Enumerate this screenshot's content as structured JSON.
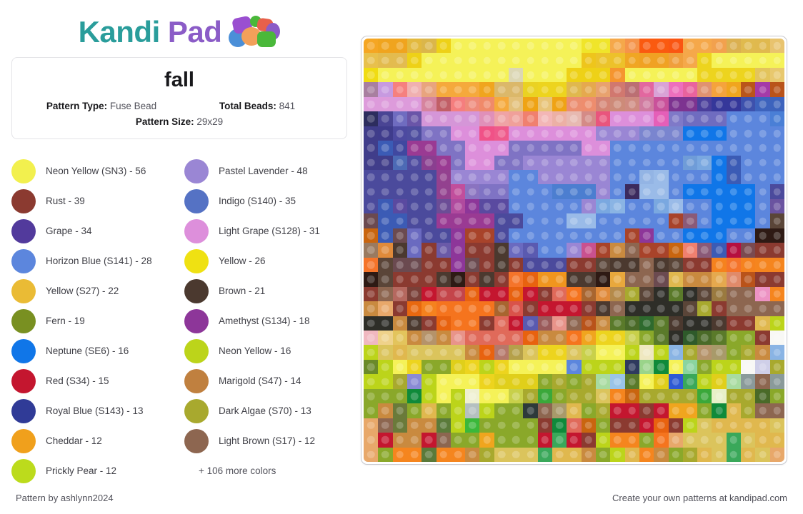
{
  "brand": {
    "name_part1": "Kandi",
    "name_part2": "Pad",
    "teal": "#2a9d9b",
    "purple": "#8b5cc7"
  },
  "info_card": {
    "title": "fall",
    "pattern_type_label": "Pattern Type:",
    "pattern_type_value": "Fuse Bead",
    "total_beads_label": "Total Beads:",
    "total_beads_value": "841",
    "pattern_size_label": "Pattern Size:",
    "pattern_size_value": "29x29"
  },
  "legend": {
    "items": [
      {
        "color": "#f2f04e",
        "label": "Neon Yellow (SN3) - 56"
      },
      {
        "color": "#9a86d4",
        "label": "Pastel Lavender - 48"
      },
      {
        "color": "#8b3a30",
        "label": "Rust - 39"
      },
      {
        "color": "#5572c4",
        "label": "Indigo (S140) - 35"
      },
      {
        "color": "#523a9c",
        "label": "Grape - 34"
      },
      {
        "color": "#dd8fdb",
        "label": "Light Grape (S128) - 31"
      },
      {
        "color": "#5c86dd",
        "label": "Horizon Blue (S141) - 28"
      },
      {
        "color": "#efe112",
        "label": "Yellow - 26"
      },
      {
        "color": "#eabb35",
        "label": "Yellow (S27) - 22"
      },
      {
        "color": "#4b392f",
        "label": "Brown - 21"
      },
      {
        "color": "#799021",
        "label": "Fern - 19"
      },
      {
        "color": "#8d3699",
        "label": "Amethyst (S134) - 18"
      },
      {
        "color": "#1076e8",
        "label": "Neptune (SE6) - 16"
      },
      {
        "color": "#bcd41a",
        "label": "Neon Yellow - 16"
      },
      {
        "color": "#c4162f",
        "label": "Red (S34) - 15"
      },
      {
        "color": "#c0803f",
        "label": "Marigold (S47) - 14"
      },
      {
        "color": "#303b97",
        "label": "Royal Blue (S143) - 13"
      },
      {
        "color": "#a8a92e",
        "label": "Dark Algae (S70) - 13"
      },
      {
        "color": "#f0a01c",
        "label": "Cheddar - 12"
      },
      {
        "color": "#8d6650",
        "label": "Light Brown (S17) - 12"
      },
      {
        "color": "#bcdb1c",
        "label": "Prickly Pear - 12"
      }
    ],
    "more_colors": "+ 106 more colors"
  },
  "pattern": {
    "rows": 29,
    "cols": 29,
    "grid": [
      [
        "#f5a623",
        "#f0a41e",
        "#f0a41e",
        "#e3b93e",
        "#dbb64a",
        "#eed117",
        "#f5f258",
        "#f5f258",
        "#f5f258",
        "#f5f258",
        "#f5f258",
        "#f5f258",
        "#f5f258",
        "#f5f258",
        "#f5f258",
        "#f0e52a",
        "#f0e52a",
        "#f5a84a",
        "#f5944a",
        "#fa5a10",
        "#fa5a10",
        "#fa5512",
        "#f5a84a",
        "#f5a84a",
        "#f2a14e",
        "#dbb050",
        "#e0ba4e",
        "#e0b94e",
        "#e8c36e"
      ],
      [
        "#e8c04c",
        "#e3bb4e",
        "#e3bb50",
        "#eed117",
        "#f5f258",
        "#f5f258",
        "#f5f258",
        "#f5f258",
        "#f5f258",
        "#f5f258",
        "#f5f258",
        "#f5f258",
        "#f5f258",
        "#f5f258",
        "#f5f258",
        "#eec51c",
        "#ecc42a",
        "#edc12a",
        "#f0a623",
        "#f0a123",
        "#f0a123",
        "#f09f3c",
        "#f5a84a",
        "#edd41e",
        "#f5f258",
        "#f5f258",
        "#f5f258",
        "#f5f258",
        "#f5f258"
      ],
      [
        "#f0dc12",
        "#f5f258",
        "#f5f258",
        "#f5f258",
        "#f5f258",
        "#f5f258",
        "#f5f258",
        "#f5f258",
        "#f5f258",
        "#f5f258",
        "#dcd7b4",
        "#f5f258",
        "#f5f258",
        "#f5f258",
        "#eed117",
        "#eed117",
        "#eed117",
        "#f5952f",
        "#f5f258",
        "#f5f258",
        "#f5f258",
        "#f5f258",
        "#f5f258",
        "#edd41e",
        "#edd41e",
        "#edd41e",
        "#edd41e",
        "#e3c45c",
        "#e8c86e"
      ],
      [
        "#a87fa0",
        "#c79ae0",
        "#f5807f",
        "#f0b0b0",
        "#e8a47e",
        "#f5a93c",
        "#f5a93c",
        "#f5a93c",
        "#f0a51e",
        "#dbb86a",
        "#dbb86a",
        "#ead222",
        "#edd41e",
        "#edd41e",
        "#e0b84e",
        "#e5a94e",
        "#e8a26e",
        "#d1786f",
        "#bb6f73",
        "#e2679f",
        "#d9a3d6",
        "#ed6fbd",
        "#e9639e",
        "#e09270",
        "#f5a33c",
        "#f0a51e",
        "#b9551a",
        "#a43aa8",
        "#b9531a"
      ],
      [
        "#dd9bdb",
        "#dd9bdb",
        "#dd9bdb",
        "#dd9bdb",
        "#d6849e",
        "#c15f66",
        "#f57e7e",
        "#ef8a7a",
        "#f08a6a",
        "#f5a93c",
        "#e3c07a",
        "#efa314",
        "#e8c478",
        "#efa314",
        "#ec8e70",
        "#ee8d6e",
        "#d58474",
        "#cd8b79",
        "#cf8a80",
        "#d07ba0",
        "#c9519a",
        "#7d3390",
        "#7d3390",
        "#4a3e9b",
        "#35379a",
        "#35379a",
        "#3d51ad",
        "#3d63bd",
        "#3d63bd"
      ],
      [
        "#2d2d5e",
        "#4a4594",
        "#6f6cc0",
        "#6a55a8",
        "#d596d8",
        "#d596d8",
        "#d596d8",
        "#d596d8",
        "#e090b9",
        "#efa3a5",
        "#f0a09a",
        "#f0806f",
        "#f3b6b6",
        "#ecb0a5",
        "#e7b9b1",
        "#d48b87",
        "#e9557d",
        "#dd8fdb",
        "#dd8fdb",
        "#dd8fdb",
        "#e55fb8",
        "#7f79c8",
        "#6f6cc0",
        "#6f6cc0",
        "#6f6cc0",
        "#5c86dd",
        "#5c86dd",
        "#5c86dd",
        "#4a7fd6"
      ],
      [
        "#403d8a",
        "#3f3c8c",
        "#4d4aa0",
        "#4e4d9f",
        "#7f73c4",
        "#7f73c4",
        "#dd8fdb",
        "#dd8fdb",
        "#f05287",
        "#ef5a8b",
        "#dd8fdb",
        "#dd8fdb",
        "#dd8fdb",
        "#dd8fdb",
        "#dd8fdb",
        "#dd8fdb",
        "#9a86d4",
        "#9a86d4",
        "#9a86d4",
        "#7a85cf",
        "#7a85cf",
        "#7a85cf",
        "#1076e8",
        "#1076e8",
        "#1076e8",
        "#5c86dd",
        "#5c86dd",
        "#5c86dd",
        "#5c86dd"
      ],
      [
        "#403d8a",
        "#3b5bb5",
        "#4048a0",
        "#9a3a93",
        "#9a3a93",
        "#7f73c4",
        "#7f73c4",
        "#dd8fdb",
        "#dd8fdb",
        "#dd8fdb",
        "#7f73c4",
        "#7f73c4",
        "#7f73c4",
        "#7f73c4",
        "#7f73c4",
        "#dd8fdb",
        "#dd8fdb",
        "#5c86dd",
        "#5c86dd",
        "#5c86dd",
        "#5c86dd",
        "#5c86dd",
        "#5c86dd",
        "#5c86dd",
        "#5c86dd",
        "#5c86dd",
        "#5c86dd",
        "#5c86dd",
        "#5c86dd"
      ],
      [
        "#403d8a",
        "#403d8a",
        "#4c6ab5",
        "#4e4ba0",
        "#8a3f90",
        "#9a3a93",
        "#7f73c4",
        "#dd8fdb",
        "#dd8fdb",
        "#7f73c4",
        "#7f73c4",
        "#9a86d4",
        "#9a86d4",
        "#9a86d4",
        "#9a86d4",
        "#9a86d4",
        "#9a86d4",
        "#5c86dd",
        "#5c86dd",
        "#5c86dd",
        "#5c86dd",
        "#5c86dd",
        "#6f9cd8",
        "#7aa8e0",
        "#1076e8",
        "#3b5bb5",
        "#5c86dd",
        "#5c86dd",
        "#5c86dd"
      ],
      [
        "#4b4a9c",
        "#4b4a9c",
        "#4b4a9c",
        "#4b4a9c",
        "#4b4a9c",
        "#93418f",
        "#9a86d4",
        "#9a86d4",
        "#9a86d4",
        "#9a86d4",
        "#5c86dd",
        "#5c86dd",
        "#9a86d4",
        "#9a86d4",
        "#9a86d4",
        "#9a86d4",
        "#9a86d4",
        "#5c86dd",
        "#5c86dd",
        "#93b4e4",
        "#9abbe8",
        "#5c86dd",
        "#5c86dd",
        "#5c86dd",
        "#1076e8",
        "#3b5bb5",
        "#5c86dd",
        "#5c86dd",
        "#5c86dd"
      ],
      [
        "#4b4a9c",
        "#4b4a9c",
        "#4b4a9c",
        "#4b4a9c",
        "#4b4a9c",
        "#93418f",
        "#c14e9c",
        "#8a73c0",
        "#7f73c4",
        "#7f73c4",
        "#5c86dd",
        "#5c86dd",
        "#5c86dd",
        "#4c7ed0",
        "#4c7ed0",
        "#4c7ed0",
        "#9a86d4",
        "#5c86dd",
        "#3b2a5e",
        "#9abbe8",
        "#9abbe8",
        "#5c86dd",
        "#1076e8",
        "#1076e8",
        "#1076e8",
        "#1076e8",
        "#1076e8",
        "#5c86dd",
        "#4b4a9c"
      ],
      [
        "#4b4a9c",
        "#3b5bb5",
        "#5a4aa0",
        "#4b4a9c",
        "#4b4a9c",
        "#6b4d96",
        "#b04a9e",
        "#8d3699",
        "#5a4aa0",
        "#5a4aa0",
        "#5c86dd",
        "#5c86dd",
        "#5c86dd",
        "#5c86dd",
        "#5c86dd",
        "#9a86d4",
        "#7aa8e0",
        "#8ab4e4",
        "#5c86dd",
        "#5c86dd",
        "#7aa8e0",
        "#9abbe8",
        "#5c86dd",
        "#5c86dd",
        "#1076e8",
        "#1076e8",
        "#1076e8",
        "#5c86dd",
        "#6a53a0"
      ],
      [
        "#6b4a50",
        "#3b5bb5",
        "#3b5bb5",
        "#4b4a9c",
        "#4b4a9c",
        "#9a3a93",
        "#9a3a93",
        "#9a3a93",
        "#9a3a93",
        "#4b4a9c",
        "#4b4a9c",
        "#5c86dd",
        "#5c86dd",
        "#5c86dd",
        "#9abbe8",
        "#9abbe8",
        "#5c86dd",
        "#5c86dd",
        "#5c86dd",
        "#5c86dd",
        "#5c86dd",
        "#a8432a",
        "#8a5a78",
        "#5c86dd",
        "#1076e8",
        "#1076e8",
        "#1076e8",
        "#5c86dd",
        "#5a4538"
      ],
      [
        "#c9650f",
        "#3b5bb5",
        "#6b4a50",
        "#6a6ac0",
        "#4b4a9c",
        "#4b4a9c",
        "#8d3699",
        "#a8432a",
        "#a8432a",
        "#4b4a9c",
        "#5c86dd",
        "#5c86dd",
        "#5c86dd",
        "#5c86dd",
        "#5c86dd",
        "#5c86dd",
        "#5c86dd",
        "#5c86dd",
        "#a8432a",
        "#8d3699",
        "#5c86dd",
        "#5c86dd",
        "#1076e8",
        "#1076e8",
        "#1076e8",
        "#5c86dd",
        "#5c86dd",
        "#2e1a14",
        "#2e1a14"
      ],
      [
        "#9a7a60",
        "#e08a3a",
        "#4b392f",
        "#6a6ac0",
        "#8b3a30",
        "#6a5aa8",
        "#8d3699",
        "#8b3a30",
        "#8b3a30",
        "#4b392f",
        "#6a6ac0",
        "#5a5ab0",
        "#5c86dd",
        "#5c86dd",
        "#9a86d4",
        "#c9518f",
        "#a8432a",
        "#c98a3f",
        "#8d6650",
        "#a8432a",
        "#a8432a",
        "#c9650f",
        "#f0806f",
        "#8a5a78",
        "#3b5bb5",
        "#b5103f",
        "#7a4a50",
        "#8b3a30",
        "#8b3a30"
      ],
      [
        "#f5742a",
        "#5a4538",
        "#6b4a50",
        "#6b4a50",
        "#8b3a30",
        "#8b3a30",
        "#8d3699",
        "#6b4a50",
        "#8b3a30",
        "#4b392f",
        "#8b3a30",
        "#4b4a9c",
        "#4b4a9c",
        "#4b4a9c",
        "#8b3a30",
        "#8b3a30",
        "#5a4538",
        "#4b392f",
        "#4b392f",
        "#8d6650",
        "#4b392f",
        "#5a4538",
        "#8b3a30",
        "#8b3a30",
        "#f5821e",
        "#f5742a",
        "#f5821e",
        "#f5851e",
        "#f5851e"
      ],
      [
        "#2e1a14",
        "#5a4538",
        "#8b3a30",
        "#8b3a30",
        "#8b3a30",
        "#4b392f",
        "#2e1a14",
        "#8b3a30",
        "#4b392f",
        "#8b3a30",
        "#f5742a",
        "#e8620f",
        "#f0951e",
        "#f0951e",
        "#4b392f",
        "#4b392f",
        "#2e1a14",
        "#e8a83c",
        "#8d6650",
        "#8d6650",
        "#6b4a50",
        "#e0b84e",
        "#c98a3f",
        "#c98a3f",
        "#e5a94e",
        "#e08a6a",
        "#b9531a",
        "#8b3a30",
        "#8b3a30"
      ],
      [
        "#8b3a30",
        "#8d6650",
        "#b5685f",
        "#7a4038",
        "#c4162f",
        "#c4454a",
        "#c4454a",
        "#e8620f",
        "#c4162f",
        "#c4162f",
        "#e8620f",
        "#c4162f",
        "#8b3a30",
        "#e06a5a",
        "#f5741e",
        "#a8652f",
        "#e08a3a",
        "#b58a4a",
        "#a8a92e",
        "#5a4538",
        "#2e2e28",
        "#5a7a2a",
        "#2e2e28",
        "#5a4538",
        "#9a7a3f",
        "#8d6650",
        "#8d6650",
        "#ed93c4",
        "#f5851e"
      ],
      [
        "#c98a3f",
        "#e8a86a",
        "#8b3a30",
        "#e8680f",
        "#f5821e",
        "#f5741e",
        "#f5741e",
        "#f5741e",
        "#f5741e",
        "#a8652f",
        "#d9534a",
        "#8b3a30",
        "#c4162f",
        "#c4162f",
        "#c4162f",
        "#8b3a30",
        "#4b392f",
        "#8d6650",
        "#2e2e28",
        "#2e2e28",
        "#2e2e28",
        "#2e2e28",
        "#5a4538",
        "#a8a92e",
        "#8b3a30",
        "#8d6650",
        "#8d6650",
        "#8d6650",
        "#8d6650"
      ],
      [
        "#2e2e28",
        "#2e2e28",
        "#c98a3f",
        "#4b392f",
        "#8b3a30",
        "#e8620f",
        "#f5741e",
        "#f5741e",
        "#8b3a30",
        "#e06a5a",
        "#c4162f",
        "#5a5ab0",
        "#9a5a5a",
        "#e8948a",
        "#8d6650",
        "#b9531a",
        "#c98a3f",
        "#5a7a2a",
        "#4a6a28",
        "#2e6a2e",
        "#5a7a2a",
        "#4b392f",
        "#2e2e28",
        "#2e2e28",
        "#4b392f",
        "#8b3a30",
        "#8b3a30",
        "#e0b84e",
        "#bcd41a"
      ],
      [
        "#f0b8c0",
        "#efd28a",
        "#e3c45c",
        "#c98a3f",
        "#b5936a",
        "#c98a3f",
        "#e8948a",
        "#e06a5a",
        "#e06a5a",
        "#e06a5a",
        "#e06a5a",
        "#e8620f",
        "#c98a3f",
        "#c98a3f",
        "#f5741e",
        "#f0a51e",
        "#edd41e",
        "#edd41e",
        "#c8d04a",
        "#8aa82a",
        "#5a7a2a",
        "#2e2e28",
        "#2e5a2a",
        "#4a6a28",
        "#5a7a2a",
        "#8aa82a",
        "#8aa82a",
        "#8b3a30",
        "#f8f8f5"
      ],
      [
        "#bcd41a",
        "#dbc45c",
        "#e0b84e",
        "#dbc45c",
        "#dbc45c",
        "#dbc45c",
        "#dbc45c",
        "#c98a3f",
        "#e8620f",
        "#b5786a",
        "#b5a04a",
        "#dbc45c",
        "#edd41e",
        "#edd41e",
        "#dbc45c",
        "#c8d04a",
        "#f5f258",
        "#f5f258",
        "#bcd41a",
        "#efe8c0",
        "#bcd41a",
        "#8ab4e4",
        "#a8a92e",
        "#b5936a",
        "#a89a6a",
        "#8aa82a",
        "#a8a92e",
        "#c98a3f",
        "#8ab4e4",
        "#2e3a8a"
      ],
      [
        "#6a8a2a",
        "#bcd41a",
        "#f5f258",
        "#edd41e",
        "#8aa82a",
        "#8aa82a",
        "#e0cf1a",
        "#edd41e",
        "#bcd41a",
        "#edd41e",
        "#f5f258",
        "#f5f258",
        "#f5f258",
        "#f5f258",
        "#5c86dd",
        "#bcd41a",
        "#bcd41a",
        "#bcd41a",
        "#2e3a5e",
        "#9ad48a",
        "#0f8a3a",
        "#f5f258",
        "#8ad4a0",
        "#8aa82a",
        "#bcd41a",
        "#bcd41a",
        "#f8f8f5",
        "#cfcfe8",
        "#a8a92e"
      ],
      [
        "#bcd41a",
        "#bcd41a",
        "#a8a92e",
        "#8a8ad4",
        "#bcd41a",
        "#f5f258",
        "#f5f258",
        "#f5f258",
        "#edd41e",
        "#e0cf1a",
        "#e0cf1a",
        "#e0cf1a",
        "#8aa82a",
        "#a8a92e",
        "#8aa82a",
        "#a8a92e",
        "#a8dba0",
        "#9ac4e8",
        "#5a7a2a",
        "#f5f258",
        "#e0cf1a",
        "#2e5ad4",
        "#3aa85a",
        "#bcd41a",
        "#e0cf1a",
        "#a8dba0",
        "#8a9a9a",
        "#8d6650",
        "#8a9a9a"
      ],
      [
        "#8aa82a",
        "#8aa82a",
        "#8aa82a",
        "#0f8a3a",
        "#bcd41a",
        "#f5f258",
        "#bcd41a",
        "#eff0d0",
        "#f5f258",
        "#f5f258",
        "#c8d04a",
        "#a8a92e",
        "#3aa83a",
        "#8aa82a",
        "#a8a92e",
        "#a8a92e",
        "#dbc45c",
        "#f5851e",
        "#c9650f",
        "#a8a92e",
        "#a8a92e",
        "#a8a92e",
        "#a8a92e",
        "#3aa83a",
        "#e8f0c8",
        "#a8a92e",
        "#a8a92e",
        "#4a6a28",
        "#8aa82a"
      ],
      [
        "#8aa82a",
        "#c98a3f",
        "#6a7a3a",
        "#8aa82a",
        "#e0b84e",
        "#8aa82a",
        "#bcd41a",
        "#b5c0c0",
        "#bcd41a",
        "#8aa82a",
        "#8aa82a",
        "#2e3a3a",
        "#8d6650",
        "#a89a6a",
        "#e0b84e",
        "#8aa82a",
        "#a8a92e",
        "#c4162f",
        "#c4162f",
        "#8b3a30",
        "#c4162f",
        "#f0a51e",
        "#f0a51e",
        "#8aa82a",
        "#0f8a3a",
        "#e0b84e",
        "#a8a92e",
        "#8d6650",
        "#8d6650"
      ],
      [
        "#e8a86a",
        "#8d6650",
        "#6a7a3a",
        "#c98a3f",
        "#c98a3f",
        "#5a7a3a",
        "#bcd41a",
        "#3ab83a",
        "#8aa82a",
        "#8aa82a",
        "#8aa82a",
        "#8aa82a",
        "#8b3a30",
        "#0f8a3a",
        "#e06a5a",
        "#c9650f",
        "#8aa82a",
        "#8b3a30",
        "#8b3a30",
        "#c4162f",
        "#e8620f",
        "#8b3a30",
        "#bcd41a",
        "#dbc45c",
        "#e0b84e",
        "#e0b84e",
        "#e0b84e",
        "#e0b84e",
        "#dbc45c"
      ],
      [
        "#e8a86a",
        "#c4162f",
        "#c98a3f",
        "#c98a3f",
        "#c4162f",
        "#8d6650",
        "#8aa82a",
        "#8aa82a",
        "#f0a51e",
        "#8aa82a",
        "#8aa82a",
        "#8aa82a",
        "#c4162f",
        "#3aa85a",
        "#c4162f",
        "#8b3a30",
        "#bcd41a",
        "#f5851e",
        "#f5851e",
        "#8aa82a",
        "#f5741e",
        "#e8a86a",
        "#dbc45c",
        "#dbc45c",
        "#dbc45c",
        "#3aa85a",
        "#dbc45c",
        "#e0b84e",
        "#e0b84e"
      ],
      [
        "#e8a86a",
        "#8aa82a",
        "#f5851e",
        "#f5851e",
        "#5a7a3a",
        "#f5851e",
        "#f5851e",
        "#c98a3f",
        "#a8a92e",
        "#dbc45c",
        "#dbc45c",
        "#dbc45c",
        "#3aa85a",
        "#e0b84e",
        "#e0b84e",
        "#c98a3f",
        "#8aa82a",
        "#bcd41a",
        "#e0b84e",
        "#f5851e",
        "#c98a3f",
        "#8aa82a",
        "#a8a92e",
        "#e0b84e",
        "#dbc45c",
        "#3aa85a",
        "#e0b84e",
        "#dbc45c",
        "#e8a86a"
      ]
    ]
  },
  "footer": {
    "left": "Pattern by ashlynn2024",
    "right": "Create your own patterns at kandipad.com"
  }
}
